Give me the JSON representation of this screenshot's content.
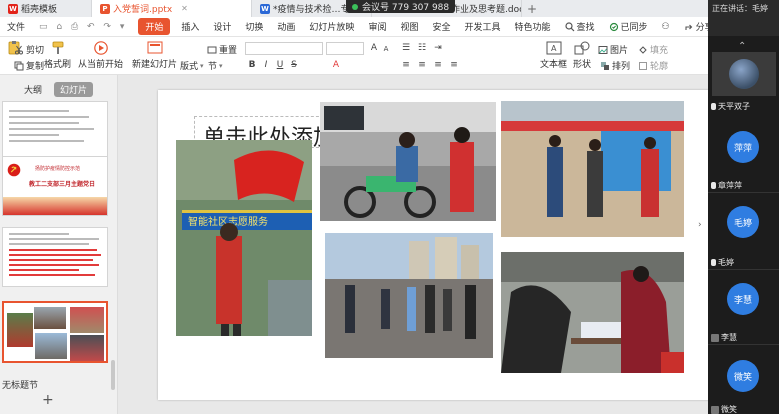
{
  "tabs": [
    {
      "icon": "wps-icon",
      "label": "稻壳模板",
      "active": false
    },
    {
      "icon": "ppt-icon",
      "label": "入党誓词.pptx",
      "active": true
    },
    {
      "icon": "doc-icon",
      "label": "*疫情与技术捡…专项项目",
      "active": false
    },
    {
      "icon": "doc-icon",
      "label": "二作业及思考题.doc",
      "active": false
    }
  ],
  "meeting": {
    "label": "会议号 779 307 988"
  },
  "menu": {
    "file": "文件",
    "start": "开始",
    "items": [
      "插入",
      "设计",
      "切换",
      "动画",
      "幻灯片放映",
      "审阅",
      "视图",
      "安全",
      "开发工具",
      "特色功能"
    ],
    "search": "查找",
    "synced": "已同步",
    "share": "分享",
    "comment": "批注"
  },
  "ribbon": {
    "cut": "剪切",
    "copy": "复制",
    "format_painter": "格式刷",
    "play_from_current": "从当前开始",
    "new_slide": "新建幻灯片",
    "layout": "版式",
    "section": "节",
    "reset": "重置",
    "textbox": "文本框",
    "shape": "形状",
    "arrange": "排列",
    "picture": "图片",
    "fill": "填充",
    "outline": "轮廓"
  },
  "left_panel": {
    "view_outline": "大纲",
    "view_slides": "幻灯片",
    "slide2_line1": "扬防护疫情防控示范",
    "slide2_line2": "教工二支部三月主题党日",
    "section_name": "无标题节"
  },
  "slide": {
    "title": "单击此处添加标题",
    "banner_text": "智能社区志愿服务"
  },
  "right_panel": {
    "header": "正在讲话：毛婷",
    "participants": [
      {
        "name": "天平双子",
        "type": "video"
      },
      {
        "name": "章萍萍",
        "avatar": "萍萍"
      },
      {
        "name": "毛婷",
        "avatar": "毛婷"
      },
      {
        "name": "李慧",
        "avatar": "李慧"
      },
      {
        "name": "微笑",
        "avatar": "微笑"
      }
    ]
  },
  "colors": {
    "accent": "#e8542f",
    "avatar_blue": "#2f7de1"
  }
}
